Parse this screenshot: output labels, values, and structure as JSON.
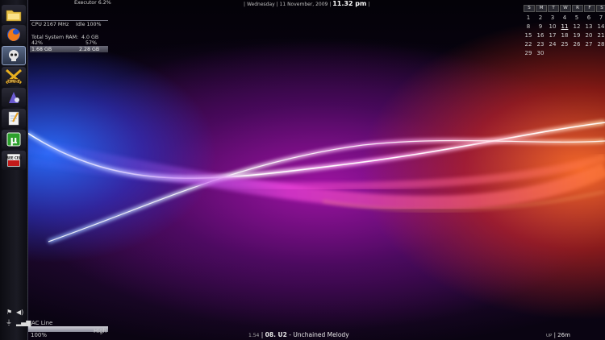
{
  "dock": {
    "items": [
      {
        "name": "folder-icon"
      },
      {
        "name": "firefox-icon"
      },
      {
        "name": "skull-app-icon"
      },
      {
        "name": "cpuz-icon"
      },
      {
        "name": "wizard-app-icon"
      },
      {
        "name": "notepad-icon"
      },
      {
        "name": "utorrent-icon",
        "glyph": "µ"
      },
      {
        "name": "freecell-icon",
        "glyph": "FREE CELL"
      }
    ]
  },
  "monitor": {
    "process": "Executor 6.2%",
    "cpu_label": "CPU 2167 MHz",
    "cpu_idle": "Idle 100%",
    "ram_label": "Total System RAM:",
    "ram_total": "4.0 GB",
    "ram_pct_left": "42%",
    "ram_pct_right": "57%",
    "ram_used": "1.68 GB",
    "ram_free": "2.28 GB"
  },
  "clock": {
    "day": "Wednesday",
    "date": "11 November, 2009",
    "time": "11.32 pm"
  },
  "calendar": {
    "headers": [
      "S",
      "M",
      "T",
      "W",
      "R",
      "F",
      "S"
    ],
    "rows": [
      [
        "",
        "",
        "",
        "",
        "",
        "",
        ""
      ],
      [
        "1",
        "2",
        "3",
        "4",
        "5",
        "6",
        "7"
      ],
      [
        "8",
        "9",
        "10",
        "11",
        "12",
        "13",
        "14"
      ],
      [
        "15",
        "16",
        "17",
        "18",
        "19",
        "20",
        "21"
      ],
      [
        "22",
        "23",
        "24",
        "25",
        "26",
        "27",
        "28"
      ],
      [
        "29",
        "30",
        "",
        "",
        "",
        "",
        ""
      ]
    ],
    "today": "11"
  },
  "power": {
    "source": "AC Line",
    "percent": "100%",
    "level_label": "High",
    "fill_fraction": 1.0
  },
  "now_playing": {
    "elapsed": "1.54",
    "track": "08. U2",
    "title": "Unchained Melody"
  },
  "uptime": {
    "label": "UP",
    "value": "26m"
  },
  "colors": {
    "accent_blue": "#2f6bff",
    "accent_magenta": "#c21bc8",
    "accent_orange": "#ff6a2a"
  }
}
